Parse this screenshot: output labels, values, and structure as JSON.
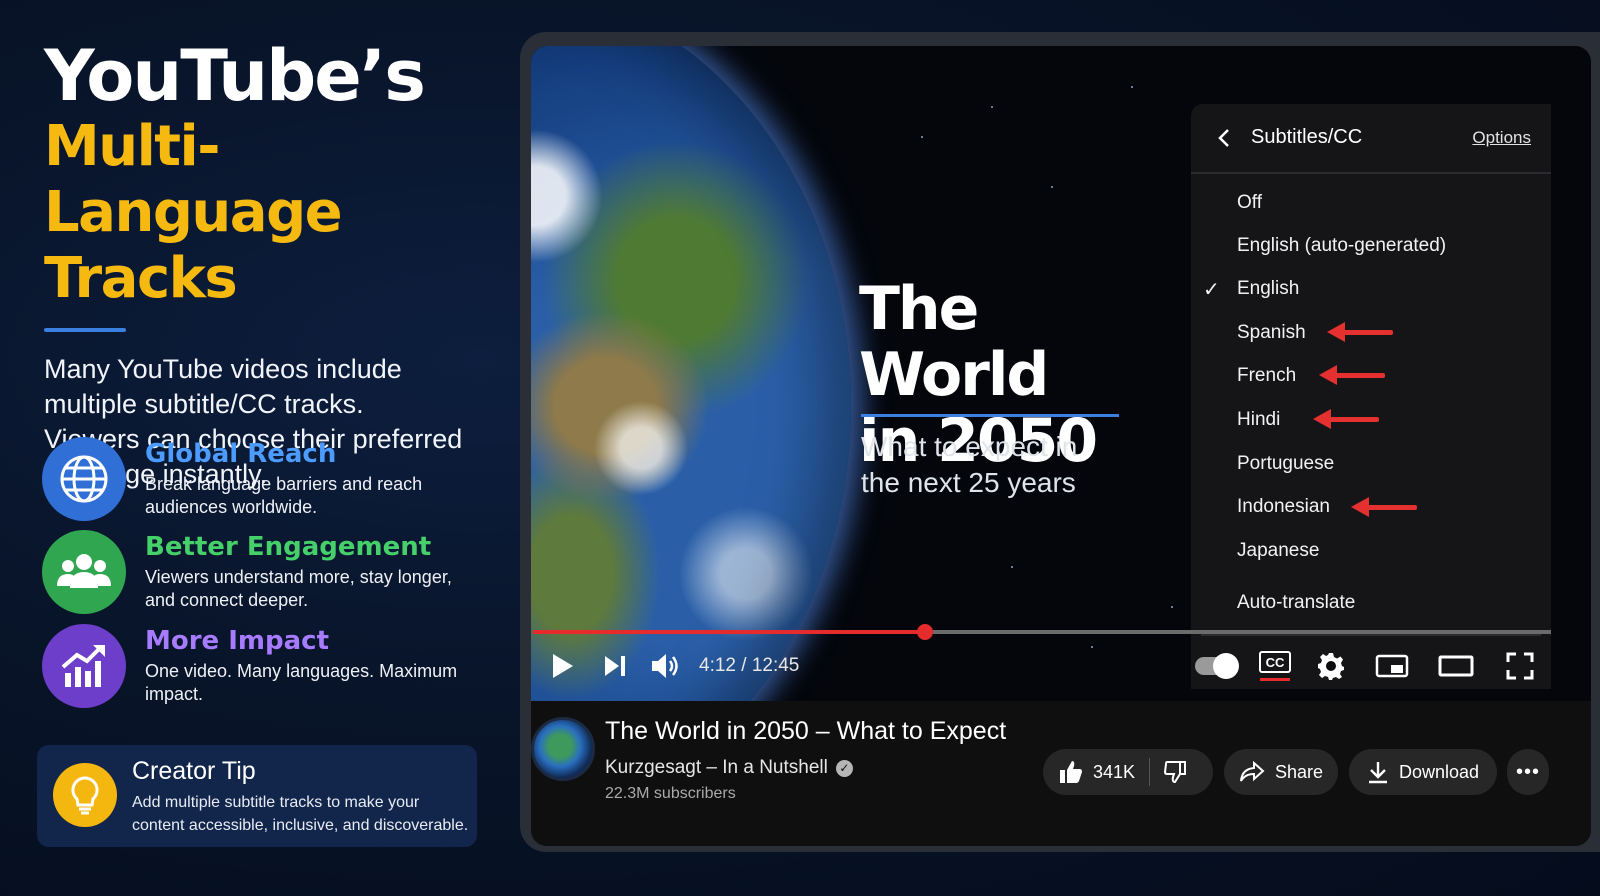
{
  "left": {
    "title_line1": "YouTube’s",
    "title_line2": "Multi-Language",
    "title_line3": "Tracks",
    "intro": "Many YouTube videos include multiple subtitle/CC tracks. Viewers can choose their preferred language instantly.",
    "features": [
      {
        "title": "Global Reach",
        "desc": "Break language barriers and reach audiences worldwide.",
        "icon": "globe-icon",
        "color": "#3b82f6"
      },
      {
        "title": "Better Engagement",
        "desc": "Viewers understand more, stay longer, and connect deeper.",
        "icon": "users-icon",
        "color": "#34c05a"
      },
      {
        "title": "More Impact",
        "desc": "One video. Many languages. Maximum impact.",
        "icon": "chart-icon",
        "color": "#8b5cf6"
      }
    ],
    "tip": {
      "title": "Creator Tip",
      "desc": "Add multiple subtitle tracks to make your content accessible, inclusive, and discoverable.",
      "icon": "lightbulb-icon"
    }
  },
  "video": {
    "title_line1": "The World",
    "title_line2": "in 2050",
    "subtitle": "What to expect in the next 25 years"
  },
  "menu": {
    "title": "Subtitles/CC",
    "options_label": "Options",
    "items": [
      "Off",
      "English (auto-generated)",
      "English",
      "Spanish",
      "French",
      "Hindi",
      "Portuguese",
      "Indonesian",
      "Japanese"
    ],
    "selected": "English",
    "highlighted": [
      "Spanish",
      "French",
      "Hindi",
      "Indonesian"
    ],
    "auto_translate": "Auto-translate"
  },
  "player": {
    "time": "4:12 / 12:45",
    "progress": 0.385,
    "cc_label": "CC",
    "accent": "#e52b2b"
  },
  "info": {
    "video_title": "The World in 2050 – What to Expect",
    "channel": "Kurzgesagt – In a Nutshell",
    "subscribers": "22.3M subscribers",
    "likes": "341K",
    "share": "Share",
    "download": "Download"
  }
}
